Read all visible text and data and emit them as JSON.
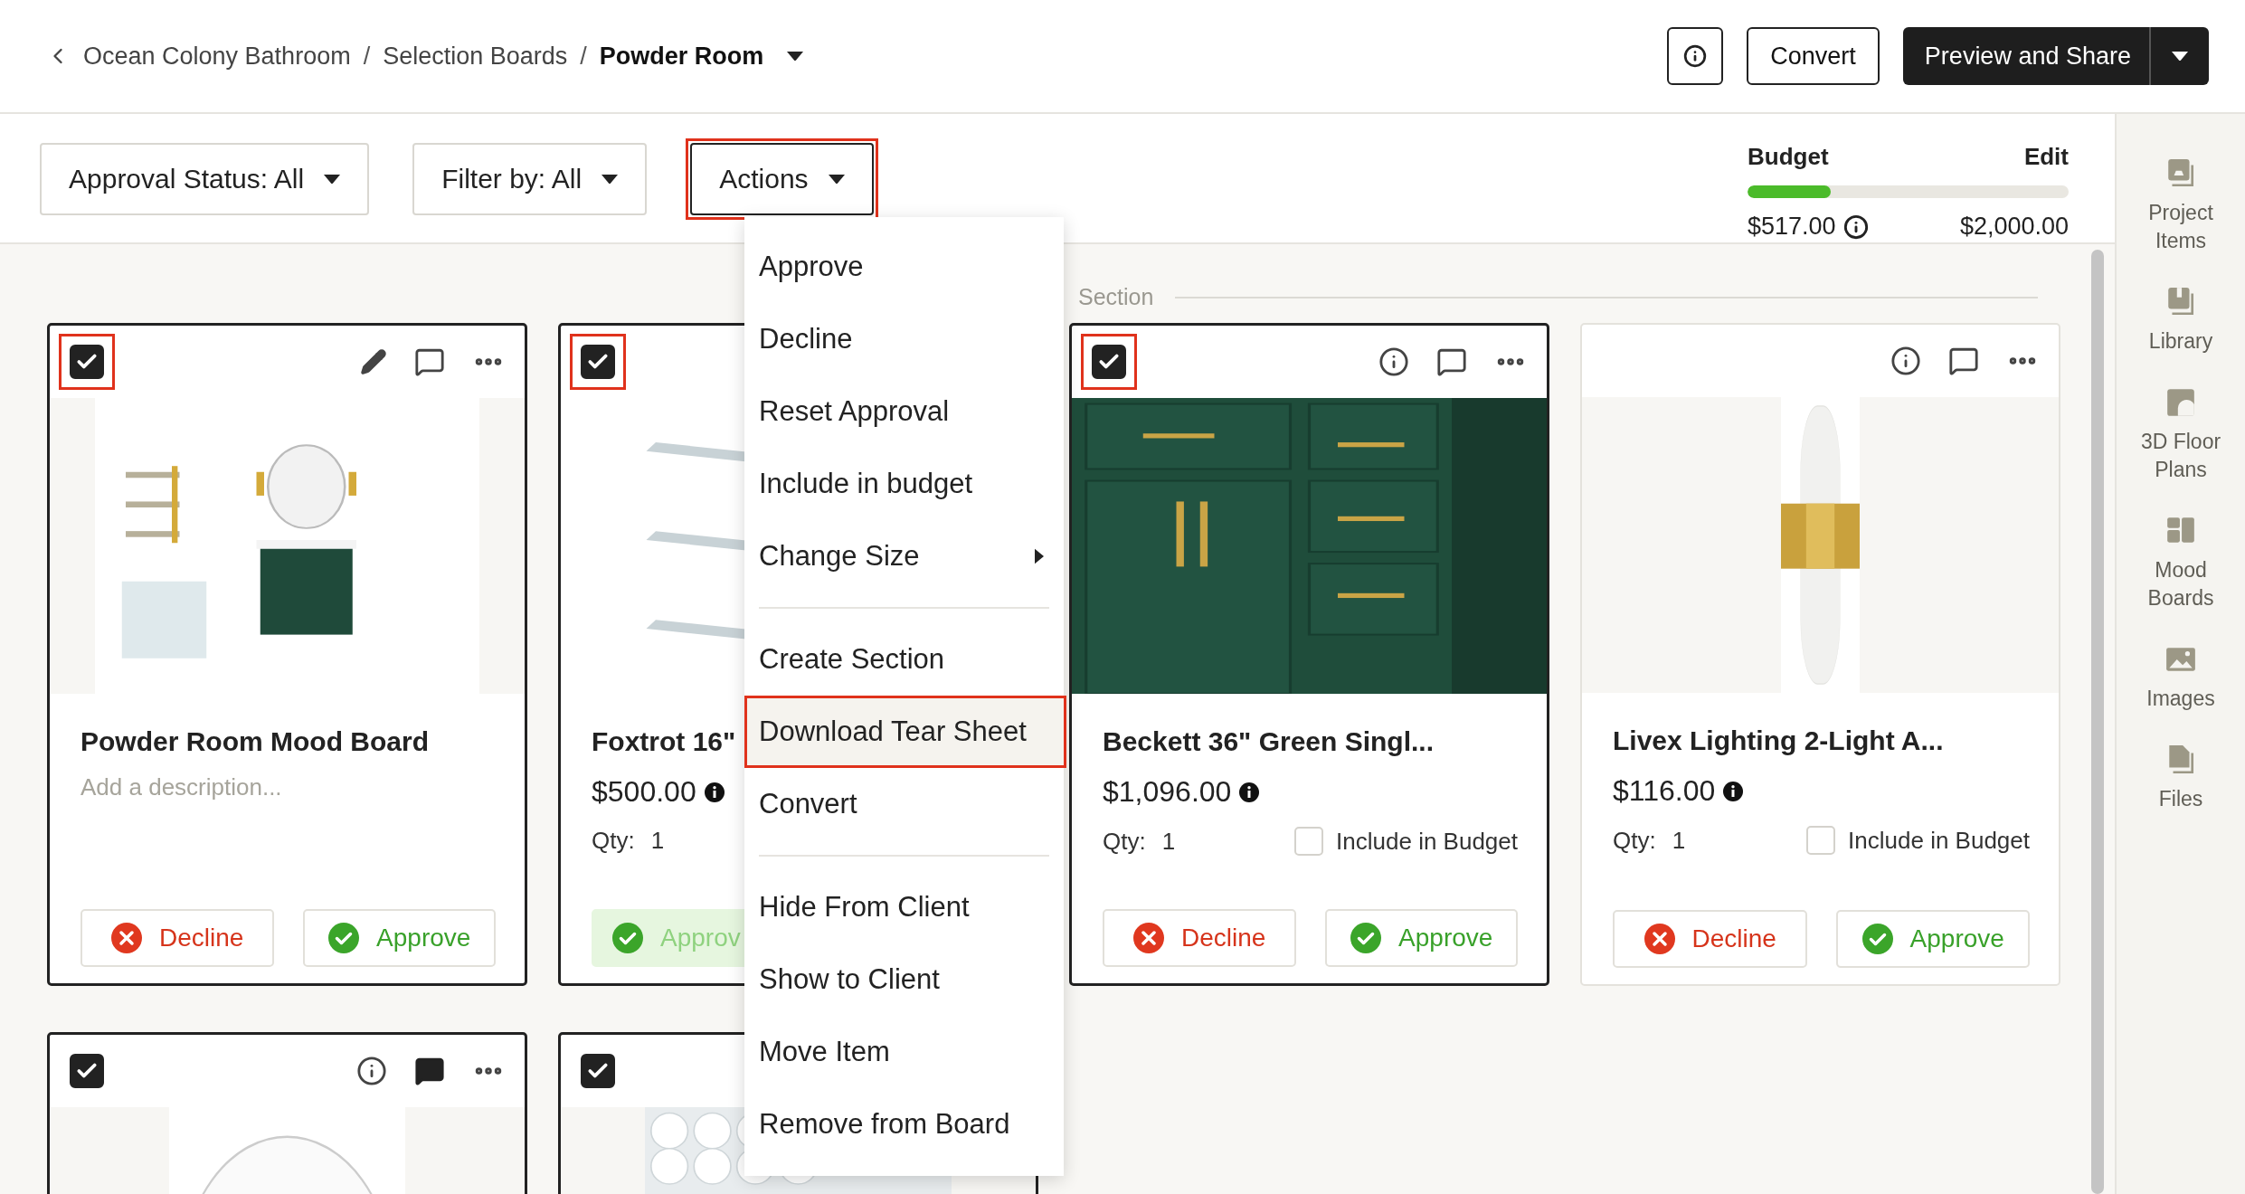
{
  "breadcrumb": [
    {
      "kind": "link",
      "label": "Ocean Colony Bathroom"
    },
    {
      "kind": "separator",
      "label": "/"
    },
    {
      "kind": "link",
      "label": "Selection Boards"
    },
    {
      "kind": "separator",
      "label": "/"
    },
    {
      "kind": "current",
      "label": "Powder Room"
    }
  ],
  "header_buttons": [
    {
      "kind": "info"
    },
    {
      "kind": "outline",
      "label": "Convert"
    },
    {
      "kind": "split",
      "label": "Preview and Share"
    }
  ],
  "filters": [
    {
      "label": "Approval Status: All",
      "highlighted": false
    },
    {
      "label": "Filter by: All",
      "highlighted": false
    },
    {
      "label": "Actions",
      "highlighted": true
    }
  ],
  "budget": {
    "title": "Budget",
    "edit": "Edit",
    "level": 0.26,
    "spent": "$517.00",
    "total": "$2,000.00"
  },
  "section": {
    "label": "Section"
  },
  "cards": [
    {
      "kind": "board",
      "selected": true,
      "highlighted": true,
      "tools": [
        {
          "kind": "edit",
          "filled": false
        },
        {
          "kind": "comment",
          "filled": false
        },
        {
          "kind": "more",
          "filled": false
        }
      ],
      "title": "Powder Room Mood Board",
      "description_placeholder": "Add a description...",
      "decline": "Decline",
      "approve": "Approve",
      "approved": false
    },
    {
      "kind": "product",
      "selected": true,
      "highlighted": true,
      "title": "Foxtrot 16\"",
      "price": "$500.00",
      "qty_label": "Qty:",
      "qty": "1",
      "approve": "Approv",
      "approved": true
    },
    {
      "kind": "product",
      "selected": true,
      "highlighted": true,
      "tools": [
        {
          "kind": "info",
          "filled": false
        },
        {
          "kind": "comment",
          "filled": false
        },
        {
          "kind": "more",
          "filled": false
        }
      ],
      "title": "Beckett 36\" Green Singl...",
      "price": "$1,096.00",
      "qty_label": "Qty:",
      "qty": "1",
      "include_label": "Include in Budget",
      "include_checked": false,
      "decline": "Decline",
      "approve": "Approve",
      "approved": false
    },
    {
      "kind": "product",
      "selected": false,
      "highlighted": false,
      "tools": [
        {
          "kind": "info",
          "filled": false
        },
        {
          "kind": "comment",
          "filled": false
        },
        {
          "kind": "more",
          "filled": false
        }
      ],
      "title": "Livex Lighting 2-Light A...",
      "price": "$116.00",
      "qty_label": "Qty:",
      "qty": "1",
      "include_label": "Include in Budget",
      "include_checked": false,
      "decline": "Decline",
      "approve": "Approve",
      "approved": false
    },
    {
      "kind": "product",
      "selected": true,
      "highlighted": false,
      "tools": [
        {
          "kind": "info",
          "filled": false
        },
        {
          "kind": "comment",
          "filled": true
        },
        {
          "kind": "more",
          "filled": false
        }
      ]
    },
    {
      "kind": "product",
      "selected": true,
      "highlighted": false
    }
  ],
  "actions_menu": [
    {
      "kind": "item",
      "label": "Approve",
      "highlighted": false
    },
    {
      "kind": "item",
      "label": "Decline",
      "highlighted": false
    },
    {
      "kind": "item",
      "label": "Reset Approval",
      "highlighted": false
    },
    {
      "kind": "item",
      "label": "Include in budget",
      "highlighted": false
    },
    {
      "kind": "submenu",
      "label": "Change Size",
      "highlighted": false
    },
    {
      "kind": "divider"
    },
    {
      "kind": "item",
      "label": "Create Section",
      "highlighted": false
    },
    {
      "kind": "item",
      "label": "Download Tear Sheet",
      "highlighted": true
    },
    {
      "kind": "item",
      "label": "Convert",
      "highlighted": false
    },
    {
      "kind": "divider"
    },
    {
      "kind": "item",
      "label": "Hide From Client",
      "highlighted": false
    },
    {
      "kind": "item",
      "label": "Show to Client",
      "highlighted": false
    },
    {
      "kind": "item",
      "label": "Move Item",
      "highlighted": false
    },
    {
      "kind": "item",
      "label": "Remove from Board",
      "highlighted": false
    }
  ],
  "sidebar": [
    {
      "kind": "items",
      "label": "Project Items"
    },
    {
      "kind": "library",
      "label": "Library"
    },
    {
      "kind": "floorplan",
      "label": "3D Floor Plans"
    },
    {
      "kind": "moodboard",
      "label": "Mood Boards"
    },
    {
      "kind": "images",
      "label": "Images"
    },
    {
      "kind": "files",
      "label": "Files"
    }
  ]
}
